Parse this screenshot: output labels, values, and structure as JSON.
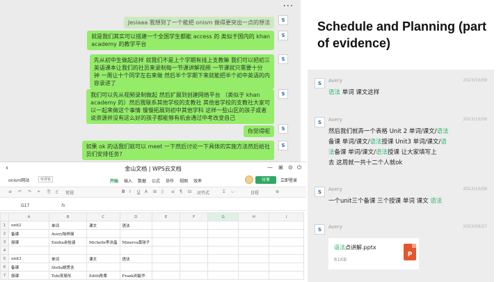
{
  "slide_title": "Schedule and Planning (part of evidence)",
  "chat": {
    "more_icon": "···",
    "avatar_glyph": "S",
    "messages": [
      "Jesiaaa 我想到了一个能把 onism 做得更突出一点的想法",
      "就是我们其实可以搭建一个全国学生都能 access 的 类似于国内的 khan",
      "academy 的教学平台",
      "先从初中生做起这样 就我们不是上个学期有线上支教嘛 我们可以把初三",
      "英语课本让我们的社员来录制每一节课讲解视频 一节课就只需要十分",
      "钟 一周让十个同学左右来做 然后半个学期下来就能把半个初中英语的内",
      "容录进了",
      "我们可以先从视频录制做起 然后扩展到创建网络平台 （类似于 khan",
      "academy 的）然后我联系其他学校的支教社 其他省学校的支教社大家可",
      "以一起来做这个事情 慢慢拓展到初中其他学科 这样一些山区的孩子或者",
      "说资源并没有这么好的孩子都能够有机会通过中考改变自己",
      "你觉得呢",
      "如果 ok 的话我们就可以 meet 一下然后讨论一下具体的实施方法然后给社",
      "员们安排任务?"
    ]
  },
  "sheet": {
    "back_icon": "‹",
    "title": "金山文档 | WPS云文档",
    "filename": "onism网站",
    "badge": "可评论",
    "menu": [
      "开始",
      "插入",
      "数据",
      "公式",
      "协作",
      "视图",
      "效率"
    ],
    "share": "分享",
    "login": "立即登录",
    "toolbar": [
      "↶",
      "↷",
      "⌖",
      "⎘",
      "Ꞇ",
      "常规",
      "B",
      "I",
      "U",
      "A",
      "⊞",
      "◊",
      "≡",
      "¶",
      "⊟",
      "对齐式",
      "Σ",
      "⌵",
      "日程",
      "⊕"
    ],
    "cell_ref": "G17",
    "fx": "fx",
    "columns": [
      "A",
      "B",
      "C",
      "D",
      "E",
      "F",
      "G",
      "H",
      "I"
    ],
    "rows": [
      [
        "1",
        "unit2",
        "单词",
        "课文",
        "语法",
        "",
        "",
        "",
        "",
        ""
      ],
      [
        "2",
        "备课",
        "Avery陆梓瑛",
        "",
        "",
        "",
        "",
        "",
        "",
        ""
      ],
      [
        "3",
        "授课",
        "Emiha余怡涵",
        "Michelle李沐晶",
        "Minerva黄铱子",
        "",
        "",
        "",
        "",
        ""
      ],
      [
        "4",
        "",
        "",
        "",
        "",
        "",
        "",
        "",
        "",
        ""
      ],
      [
        "5",
        "unit3",
        "单词",
        "课文",
        "语法",
        "",
        "",
        "",
        "",
        ""
      ],
      [
        "6",
        "备课",
        "Stella姚思含",
        "",
        "",
        "",
        "",
        "",
        "",
        ""
      ],
      [
        "7",
        "授课",
        "Tobi吴易彤",
        "Edith陈柔",
        "Frank刘能华",
        "",
        "",
        "",
        "",
        ""
      ]
    ]
  },
  "history": {
    "avatar_glyph": "S",
    "entries": [
      {
        "name": "Avery",
        "date": "2023/10/09",
        "lines": [
          [
            [
              "语法",
              true
            ],
            [
              " 单词 课文这样",
              false
            ]
          ]
        ]
      },
      {
        "name": "Avery",
        "date": "2023/10/09",
        "lines": [
          [
            [
              "然后我们就弄一个表格 Unit 2 单词/课文/",
              false
            ],
            [
              "语法",
              true
            ]
          ],
          [
            [
              "备课 单词/课文/",
              false
            ],
            [
              "语法",
              true
            ],
            [
              "授课 Unit3 单词/课文/",
              false
            ],
            [
              "语",
              true
            ]
          ],
          [
            [
              "法",
              true
            ],
            [
              "备课 单词/课文/",
              false
            ],
            [
              "语法",
              true
            ],
            [
              "授课 让大家填写上",
              false
            ]
          ],
          [
            [
              "去 这周就一共十二个人就ok",
              false
            ]
          ]
        ]
      },
      {
        "name": "Avery",
        "date": "2023/10/09",
        "lines": [
          [
            [
              "一个unit三个备课 三个授课 单词 课文 ",
              false
            ],
            [
              "语法",
              true
            ]
          ]
        ]
      },
      {
        "name": "Avery",
        "date": "2023/09/27",
        "lines": []
      }
    ],
    "file": {
      "name_green": "语法",
      "name_rest": "点讲解.pptx",
      "size": "61KB",
      "icon_letter": "P"
    }
  }
}
